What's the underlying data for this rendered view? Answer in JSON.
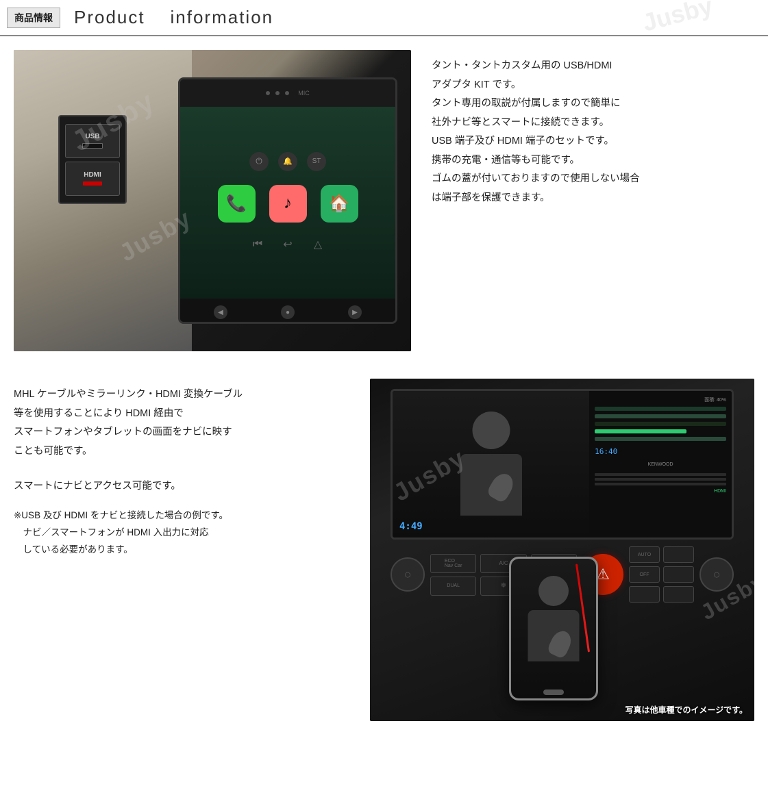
{
  "header": {
    "jp_label": "商品情報",
    "en_label_1": "Product",
    "en_label_2": "information"
  },
  "top_section": {
    "description_lines": [
      "タント・タントカスタム用の USB/HDMI",
      "アダプタ KIT です。",
      "タント専用の取説が付属しますので簡単に",
      "社外ナビ等とスマートに接続できます。",
      "USB 端子及び HDMI 端子のセットです。",
      "携帯の充電・通信等も可能です。",
      "ゴムの蓋が付いておりますので使用しない場合",
      "は端子部を保護できます。"
    ]
  },
  "bottom_section": {
    "main_lines": [
      "MHL ケーブルやミラーリンク・HDMI 変換ケーブル",
      "等を使用することにより HDMI 経由で",
      "スマートフォンやタブレットの画面をナビに映す",
      "ことも可能です。",
      "スマートにナビとアクセス可能です。"
    ],
    "note_lines": [
      "※USB 及び HDMI をナビと接続した場合の例です。",
      "　ナビ／スマートフォンが HDMI 入出力に対応",
      "　している必要があります。"
    ],
    "photo_caption": "写真は他車種でのイメージです。"
  },
  "usb_panel": {
    "usb_label": "USB",
    "hdmi_label": "HDMI"
  },
  "watermarks": [
    "Jusby",
    "Jusby",
    "Jusby"
  ]
}
